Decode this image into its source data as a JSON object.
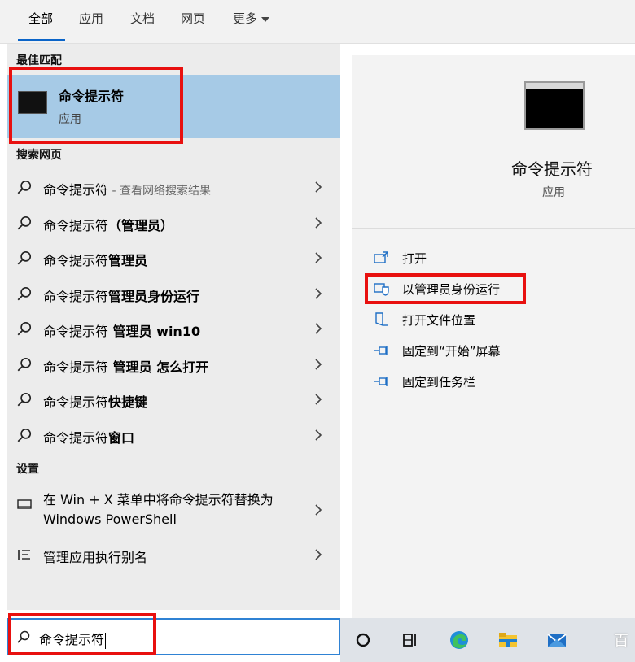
{
  "tabs": [
    {
      "label": "全部"
    },
    {
      "label": "应用"
    },
    {
      "label": "文档"
    },
    {
      "label": "网页"
    },
    {
      "label": "更多"
    }
  ],
  "sections": {
    "best_match": "最佳匹配",
    "search_web": "搜索网页",
    "settings": "设置"
  },
  "best_match": {
    "title": "命令提示符",
    "subtitle": "应用"
  },
  "web_results": [
    {
      "text": "命令提示符",
      "bold": "",
      "dim": " - 查看网络搜索结果"
    },
    {
      "text": "命令提示符",
      "bold": "（管理员）",
      "dim": ""
    },
    {
      "text": "命令提示符",
      "bold": "管理员",
      "dim": ""
    },
    {
      "text": "命令提示符",
      "bold": "管理员身份运行",
      "dim": ""
    },
    {
      "text": "命令提示符",
      "bold": " 管理员 win10",
      "dim": ""
    },
    {
      "text": "命令提示符",
      "bold": " 管理员 怎么打开",
      "dim": ""
    },
    {
      "text": "命令提示符",
      "bold": "快捷键",
      "dim": ""
    },
    {
      "text": "命令提示符",
      "bold": "窗口",
      "dim": ""
    }
  ],
  "settings_results": [
    {
      "text": "在 Win + X 菜单中将命令提示符替换为 Windows PowerShell"
    },
    {
      "text": "管理应用执行别名"
    }
  ],
  "search": {
    "value": "命令提示符"
  },
  "detail": {
    "title": "命令提示符",
    "subtitle": "应用",
    "actions": [
      {
        "label": "打开"
      },
      {
        "label": "以管理员身份运行"
      },
      {
        "label": "打开文件位置"
      },
      {
        "label": "固定到“开始”屏幕"
      },
      {
        "label": "固定到任务栏"
      }
    ]
  },
  "taskbar": {
    "corner_text": "百"
  },
  "colors": {
    "accent": "#0a64c8",
    "selection": "#a6cae6",
    "highlight": "#e8100f"
  }
}
